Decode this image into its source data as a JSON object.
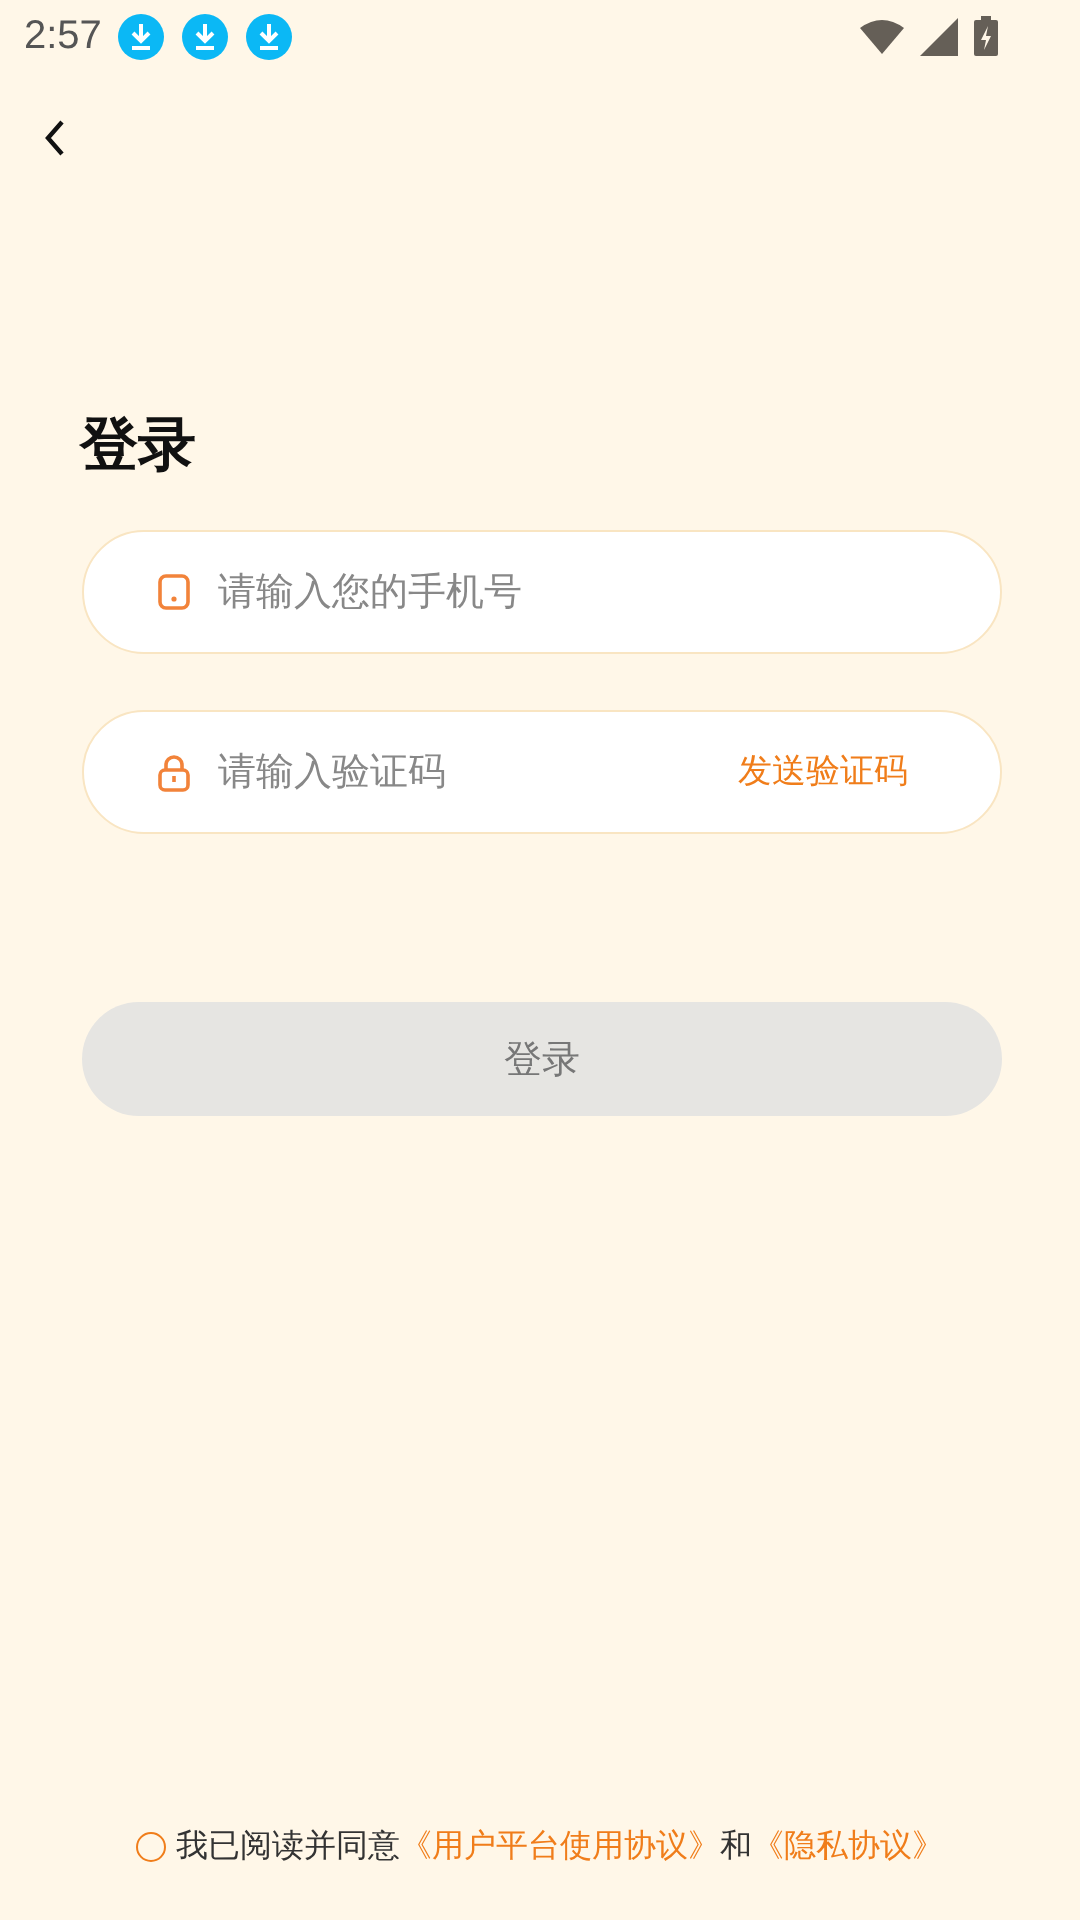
{
  "status_bar": {
    "time": "2:57",
    "notifications": [
      {
        "kind": "download"
      },
      {
        "kind": "download"
      },
      {
        "kind": "download"
      }
    ]
  },
  "title": "登录",
  "fields": [
    {
      "kind": "phone",
      "placeholder": "请输入您的手机号"
    },
    {
      "kind": "code",
      "placeholder": "请输入验证码",
      "action": "发送验证码"
    }
  ],
  "login_button": {
    "label": "登录",
    "disabled": true
  },
  "agreement": {
    "checked": false,
    "text": "我已阅读并同意",
    "link_1": "《用户平台使用协议》",
    "joiner": "和",
    "link_2": "《隐私协议》"
  }
}
